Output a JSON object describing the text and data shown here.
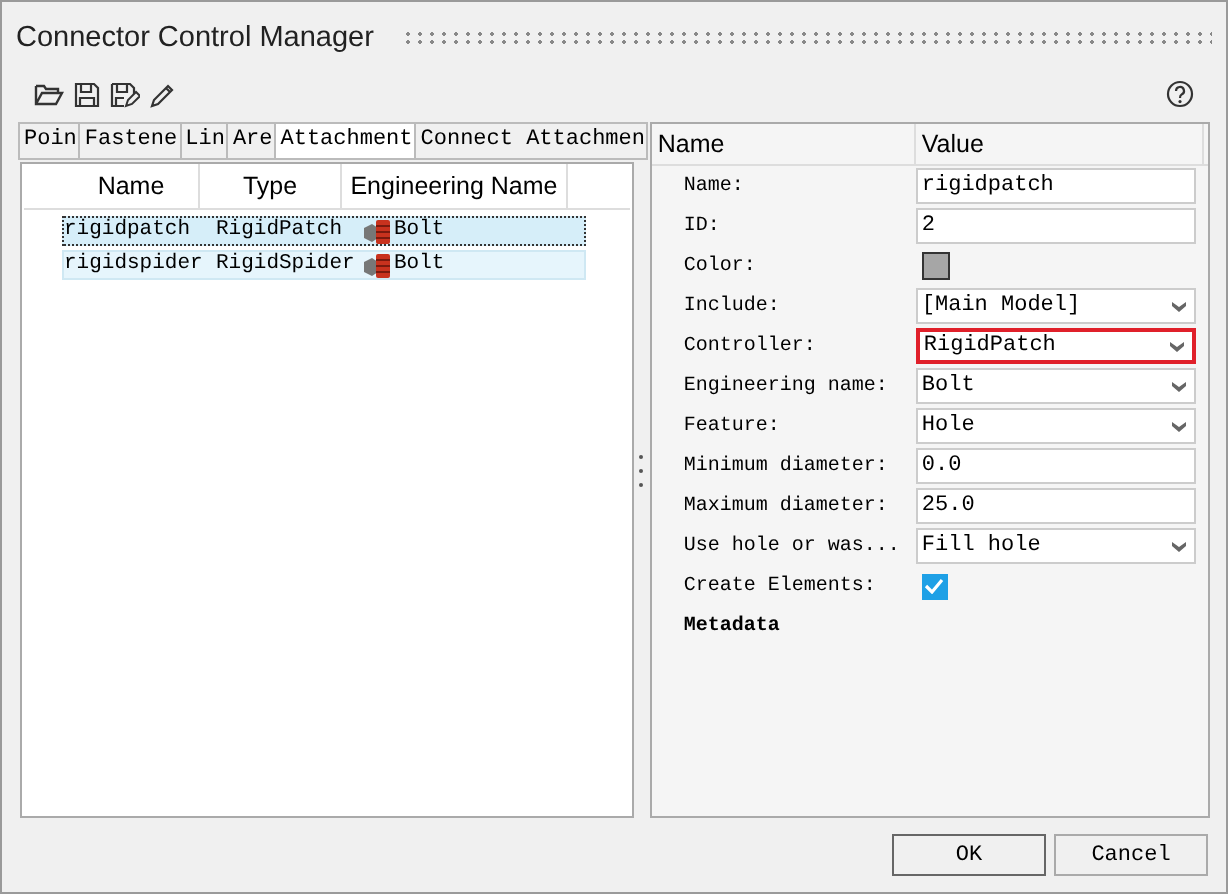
{
  "window": {
    "title": "Connector Control Manager"
  },
  "tabs": [
    {
      "label": "Poin",
      "selected": false
    },
    {
      "label": "Fastene",
      "selected": false
    },
    {
      "label": "Lin",
      "selected": false
    },
    {
      "label": "Are",
      "selected": false
    },
    {
      "label": "Attachment",
      "selected": true
    },
    {
      "label": "Connect Attachmen",
      "selected": false
    }
  ],
  "table": {
    "columns": [
      "Name",
      "Type",
      "Engineering Name"
    ],
    "rows": [
      {
        "cells": [
          "rigidpatch",
          "RigidPatch",
          "Bolt"
        ],
        "selected": true
      },
      {
        "cells": [
          "rigidspider",
          "RigidSpider",
          "Bolt"
        ],
        "selected": false
      }
    ]
  },
  "properties": {
    "columns": [
      "Name",
      "Value"
    ],
    "rows": [
      {
        "kind": "text",
        "label": "Name:",
        "value": "rigidpatch"
      },
      {
        "kind": "text",
        "label": "ID:",
        "value": "2"
      },
      {
        "kind": "color",
        "label": "Color:",
        "color": "#a6a6a6"
      },
      {
        "kind": "dropdown",
        "label": "Include:",
        "value": "[Main Model]",
        "highlighted": false
      },
      {
        "kind": "dropdown",
        "label": "Controller:",
        "value": "RigidPatch",
        "highlighted": true
      },
      {
        "kind": "dropdown",
        "label": "Engineering name:",
        "value": "Bolt",
        "highlighted": false
      },
      {
        "kind": "dropdown",
        "label": "Feature:",
        "value": "Hole",
        "highlighted": false
      },
      {
        "kind": "text",
        "label": "Minimum diameter:",
        "value": "0.0"
      },
      {
        "kind": "text",
        "label": "Maximum diameter:",
        "value": "25.0"
      },
      {
        "kind": "dropdown",
        "label": "Use hole or was...",
        "value": "Fill hole",
        "highlighted": false
      },
      {
        "kind": "checkbox",
        "label": "Create Elements:",
        "checked": true
      },
      {
        "kind": "heading",
        "label": "Metadata"
      }
    ]
  },
  "buttons": [
    "OK",
    "Cancel"
  ]
}
